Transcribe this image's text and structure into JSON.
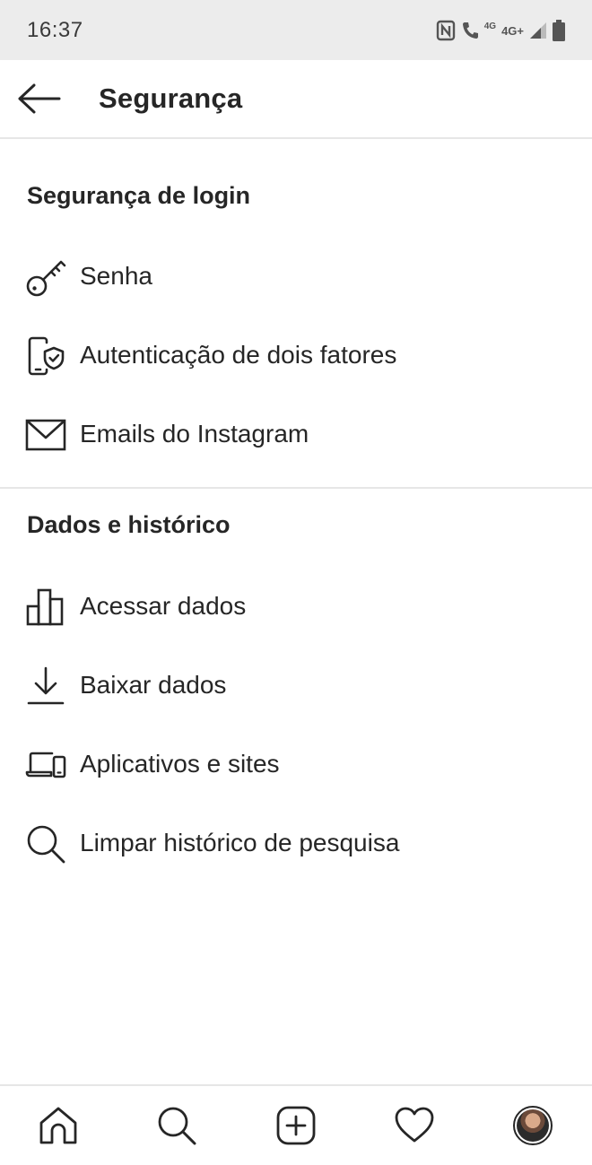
{
  "status_bar": {
    "time": "16:37",
    "network_small": "4G",
    "network": "4G+"
  },
  "header": {
    "title": "Segurança"
  },
  "sections": [
    {
      "title": "Segurança de login",
      "items": [
        {
          "label": "Senha",
          "icon": "key-icon"
        },
        {
          "label": "Autenticação de dois fatores",
          "icon": "phone-shield-icon"
        },
        {
          "label": "Emails do Instagram",
          "icon": "envelope-icon"
        }
      ]
    },
    {
      "title": "Dados e histórico",
      "items": [
        {
          "label": "Acessar dados",
          "icon": "bar-chart-icon"
        },
        {
          "label": "Baixar dados",
          "icon": "download-icon"
        },
        {
          "label": "Aplicativos e sites",
          "icon": "devices-icon"
        },
        {
          "label": "Limpar histórico de pesquisa",
          "icon": "search-icon"
        }
      ]
    }
  ],
  "bottom_nav": {
    "items": [
      "home-icon",
      "search-icon",
      "new-post-icon",
      "activity-heart-icon",
      "profile-avatar"
    ]
  },
  "colors": {
    "text": "#262626",
    "status_bar_bg": "#ececec",
    "divider": "#e6e6e6"
  }
}
